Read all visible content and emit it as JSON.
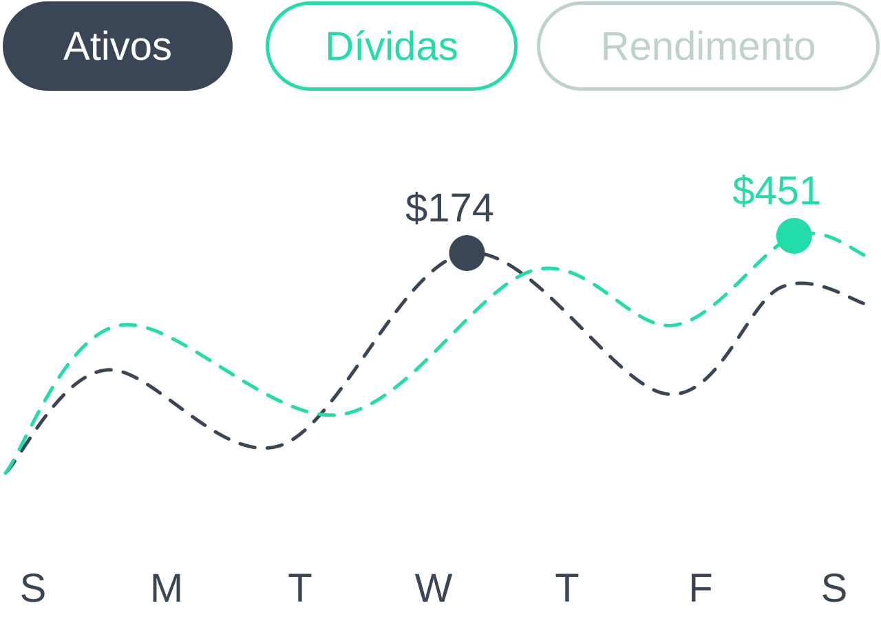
{
  "tabs": [
    {
      "label": "Ativos",
      "state": "selected"
    },
    {
      "label": "Dívidas",
      "state": "outlined"
    },
    {
      "label": "Rendimento",
      "state": "inactive"
    }
  ],
  "colors": {
    "dark": "#3a4656",
    "green": "#22dcaa",
    "inactive": "#bfd1cb",
    "white": "#ffffff"
  },
  "chart_data": {
    "type": "line",
    "categories": [
      "S",
      "M",
      "T",
      "W",
      "T",
      "F",
      "S"
    ],
    "ylim": [
      0,
      500
    ],
    "grid": false,
    "legend": "none",
    "series": [
      {
        "color": "dark",
        "dashed": true,
        "x": [
          0,
          0.55,
          1.85,
          3.25,
          4.75,
          5.6,
          6.25
        ],
        "values": [
          0,
          150,
          40,
          320,
          115,
          270,
          245
        ],
        "highlight": {
          "x": 3.25,
          "value": 320,
          "label": "$174"
        }
      },
      {
        "color": "green",
        "dashed": true,
        "x": [
          0,
          0.65,
          2.3,
          3.75,
          4.8,
          5.7,
          6.25
        ],
        "values": [
          0,
          215,
          85,
          295,
          215,
          345,
          315
        ],
        "highlight": {
          "x": 5.7,
          "value": 345,
          "label": "$451"
        }
      }
    ]
  }
}
